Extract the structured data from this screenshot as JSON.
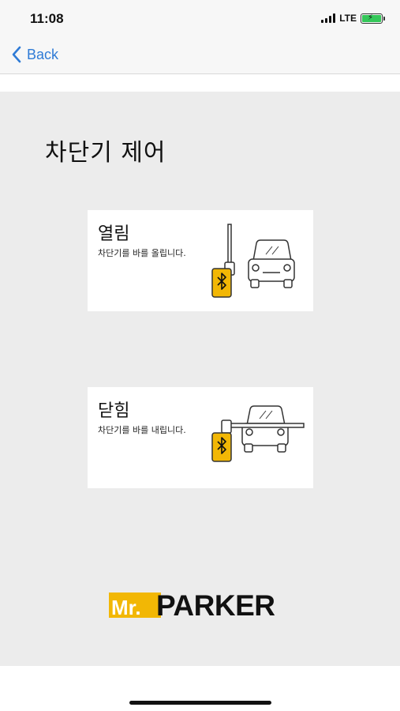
{
  "status_bar": {
    "time": "11:08",
    "network": "LTE",
    "battery_charging": true
  },
  "nav": {
    "back_label": "Back"
  },
  "page": {
    "title": "차단기 제어"
  },
  "cards": {
    "open": {
      "title": "열림",
      "desc": "차단기를 바를 올립니다."
    },
    "close": {
      "title": "닫힘",
      "desc": "차단기를 바를 내립니다."
    }
  },
  "brand": {
    "prefix": "Mr.",
    "name": "PARKER"
  },
  "colors": {
    "accent_yellow": "#f2b705",
    "link_blue": "#2f7bd6",
    "content_bg": "#ececec"
  },
  "icons": [
    "chevron-left-icon",
    "signal-icon",
    "battery-icon",
    "bluetooth-icon",
    "car-icon",
    "barrier-gate-icon"
  ]
}
